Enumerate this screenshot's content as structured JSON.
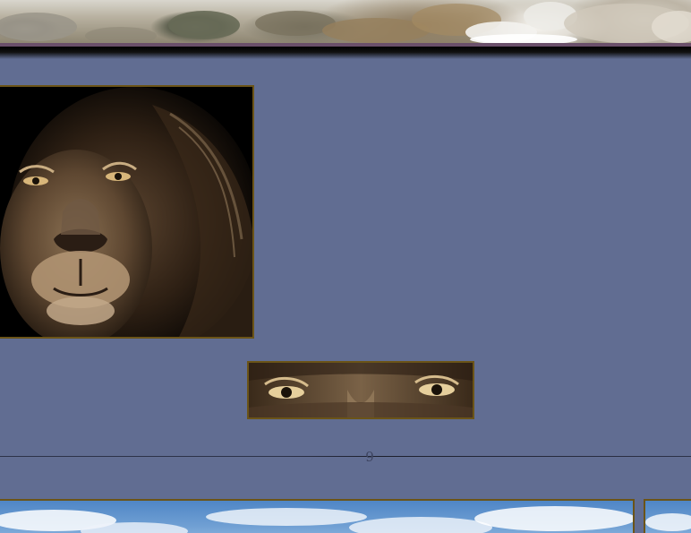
{
  "banner": {
    "image_name": "waterfall-rocks-banner"
  },
  "gallery": {
    "images": [
      {
        "name": "lion-portrait-photo"
      },
      {
        "name": "lion-eyes-photo"
      }
    ]
  },
  "pagination": {
    "page_number": "9"
  },
  "bottom_gallery": {
    "images": [
      {
        "name": "sky-clouds-photo"
      },
      {
        "name": "sky-clouds-photo-2"
      }
    ]
  },
  "colors": {
    "page_background": "#616d92",
    "frame_border": "#6b5418",
    "banner_edge": "#6a4f6a"
  }
}
